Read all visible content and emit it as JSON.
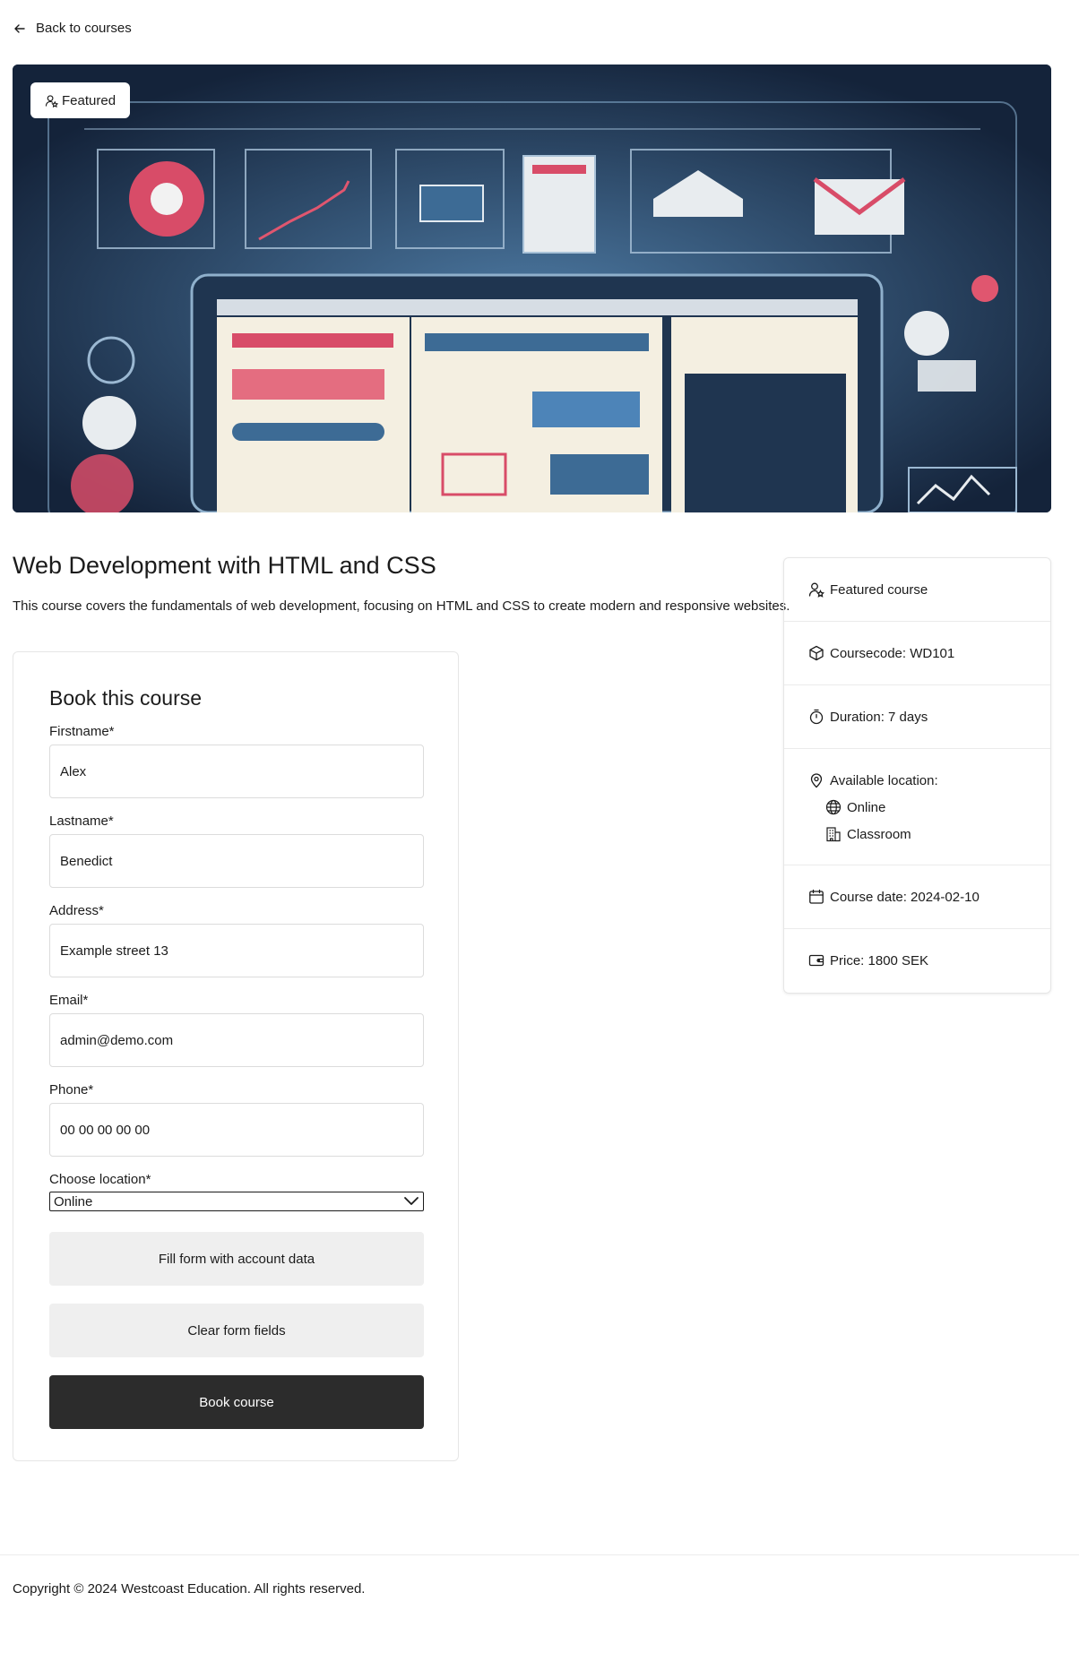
{
  "nav": {
    "back_label": "Back to courses"
  },
  "hero": {
    "badge_label": "Featured"
  },
  "course": {
    "title": "Web Development with HTML and CSS",
    "description": "This course covers the fundamentals of web development, focusing on HTML and CSS to create modern and responsive websites."
  },
  "booking": {
    "title": "Book this course",
    "firstname": {
      "label": "Firstname*",
      "value": "Alex"
    },
    "lastname": {
      "label": "Lastname*",
      "value": "Benedict"
    },
    "address": {
      "label": "Address*",
      "value": "Example street 13"
    },
    "email": {
      "label": "Email*",
      "value": "admin@demo.com"
    },
    "phone": {
      "label": "Phone*",
      "value": "00 00 00 00 00"
    },
    "location": {
      "label": "Choose location*",
      "selected": "Online"
    },
    "fill_button": "Fill form with account data",
    "clear_button": "Clear form fields",
    "submit_button": "Book course"
  },
  "info": {
    "featured": "Featured course",
    "coursecode": "Coursecode: WD101",
    "duration": "Duration: 7 days",
    "available_location": "Available location:",
    "locations": [
      "Online",
      "Classroom"
    ],
    "course_date": "Course date: 2024-02-10",
    "price": "Price: 1800 SEK"
  },
  "footer": {
    "copyright": "Copyright © 2024 Westcoast Education. All rights reserved."
  },
  "icons": {
    "back": "arrow-left-icon",
    "featured": "user-star-icon",
    "coursecode": "box-icon",
    "duration": "stopwatch-icon",
    "location": "map-pin-icon",
    "online": "globe-icon",
    "classroom": "building-icon",
    "date": "calendar-icon",
    "price": "wallet-icon",
    "select": "chevron-down-icon"
  },
  "colors": {
    "text": "#1b1b1b",
    "primary_button": "#2c2c2c",
    "secondary_button": "#efefef",
    "hero_bg": "#1d3048",
    "accent_pink": "#e0566f"
  }
}
